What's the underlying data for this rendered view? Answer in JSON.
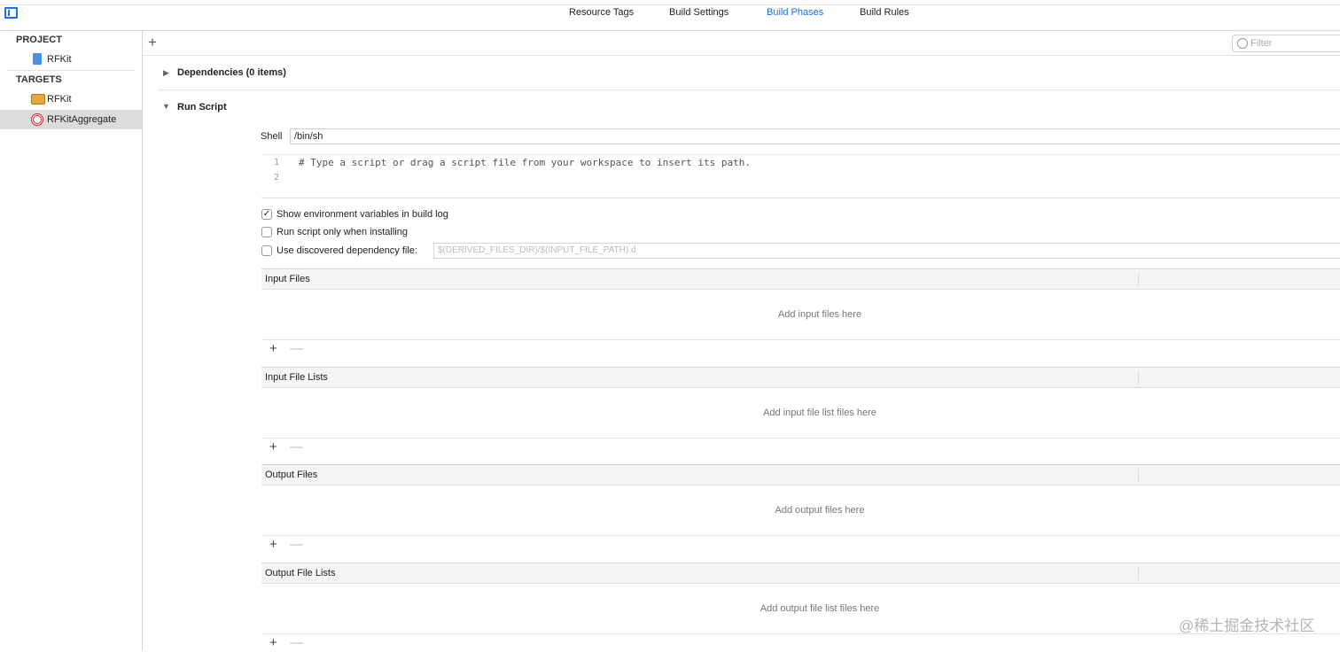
{
  "tabs": [
    {
      "label": "Resource Tags"
    },
    {
      "label": "Build Settings"
    },
    {
      "label": "Build Phases",
      "active": true
    },
    {
      "label": "Build Rules"
    }
  ],
  "sidebar": {
    "project_header": "PROJECT",
    "project_items": [
      {
        "label": "RFKit",
        "icon": "project-file-icon"
      }
    ],
    "targets_header": "TARGETS",
    "target_items": [
      {
        "label": "RFKit",
        "icon": "framework-toolbox-icon"
      },
      {
        "label": "RFKitAggregate",
        "icon": "aggregate-target-icon",
        "selected": true
      }
    ]
  },
  "toolbar": {
    "add": "+",
    "filter_placeholder": "Filter"
  },
  "phases": {
    "dependencies": "Dependencies (0 items)",
    "run_script": "Run Script"
  },
  "run_script": {
    "shell_label": "Shell",
    "shell_value": "/bin/sh",
    "script_lines": [
      {
        "n": "1",
        "text": "# Type a script or drag a script file from your workspace to insert its path."
      },
      {
        "n": "2",
        "text": ""
      }
    ],
    "options": [
      {
        "label": "Show environment variables in build log",
        "checked": true,
        "mark": "✓"
      },
      {
        "label": "Run script only when installing",
        "checked": false
      },
      {
        "label": "Use discovered dependency file:",
        "checked": false
      }
    ],
    "dependency_file_placeholder": "$(DERIVED_FILES_DIR)/$(INPUT_FILE_PATH).d",
    "file_sections": [
      {
        "title": "Input Files",
        "empty": "Add input files here"
      },
      {
        "title": "Input File Lists",
        "empty": "Add input file list files here"
      },
      {
        "title": "Output Files",
        "empty": "Add output files here"
      },
      {
        "title": "Output File Lists",
        "empty": "Add output file list files here"
      }
    ],
    "plus": "+",
    "minus": "—"
  },
  "watermark": "@稀土掘金技术社区"
}
